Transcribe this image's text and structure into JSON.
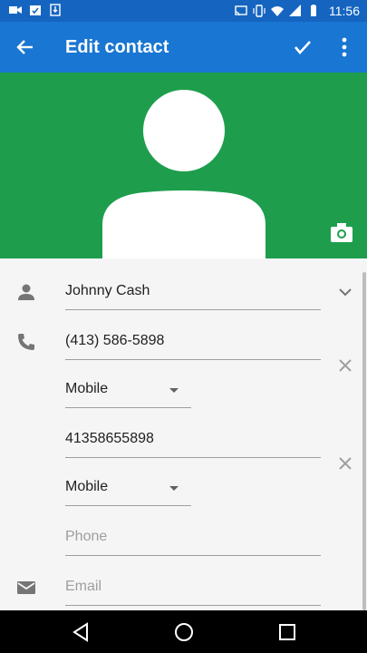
{
  "status_bar": {
    "time": "11:56",
    "left_icons": [
      "video-camera-icon",
      "calendar-check-icon",
      "download-icon"
    ],
    "right_icons": [
      "cast-icon",
      "vibrate-icon",
      "wifi-icon",
      "signal-icon",
      "battery-icon"
    ]
  },
  "app_bar": {
    "title": "Edit contact",
    "color": "#1976d2"
  },
  "header": {
    "background": "#1e9e4d"
  },
  "form": {
    "name": {
      "value": "Johnny Cash"
    },
    "phones": [
      {
        "value": "(413) 586-5898",
        "type": "Mobile"
      },
      {
        "value": "41358655898",
        "type": "Mobile"
      }
    ],
    "phone_placeholder": "Phone",
    "email_placeholder": "Email"
  }
}
